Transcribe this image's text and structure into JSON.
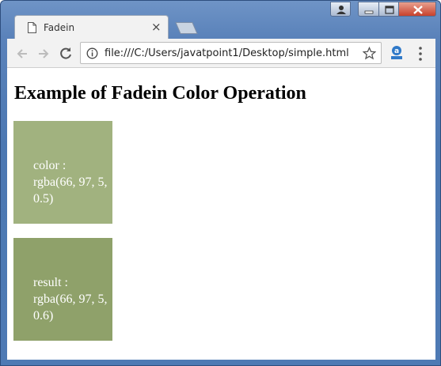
{
  "browser": {
    "tab_title": "Fadein",
    "tab_close": "×",
    "url": "file:///C:/Users/javatpoint1/Desktop/simple.html"
  },
  "icons": {
    "page": "page-icon",
    "close": "close-icon",
    "new_tab": "new-tab-icon",
    "user": "user-icon",
    "minimize": "minimize-icon",
    "maximize": "maximize-icon",
    "window_close": "window-close-icon",
    "back": "back-arrow-icon",
    "forward": "forward-arrow-icon",
    "reload": "reload-icon",
    "info": "info-icon",
    "star": "star-icon",
    "extension": "extension-icon",
    "menu": "menu-dots-icon"
  },
  "page": {
    "heading": "Example of Fadein Color Operation",
    "box1_label": "color :",
    "box1_value": "rgba(66, 97, 5, 0.5)",
    "box2_label": "result :",
    "box2_value": "rgba(66, 97, 5, 0.6)"
  },
  "colors": {
    "box1": "#a1b27f",
    "box2": "#8fa16a",
    "frame": "#4e7ab4"
  }
}
